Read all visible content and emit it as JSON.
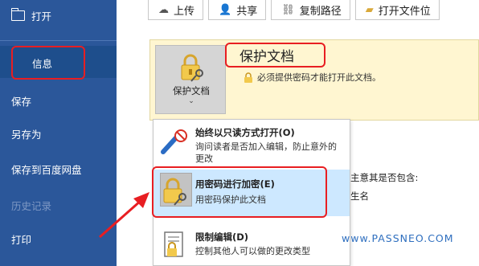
{
  "sidebar": {
    "open_label": "打开",
    "items": [
      {
        "label": "信息"
      },
      {
        "label": "保存"
      },
      {
        "label": "另存为"
      },
      {
        "label": "保存到百度网盘"
      },
      {
        "label": "历史记录"
      },
      {
        "label": "打印"
      }
    ]
  },
  "toolbar": {
    "upload": "上传",
    "share": "共享",
    "copy_path": "复制路径",
    "open_location": "打开文件位"
  },
  "protect": {
    "button_label": "保护文档",
    "chevron": "⌄",
    "title": "保护文档",
    "description": "必须提供密码才能打开此文档。"
  },
  "menu": {
    "items": [
      {
        "title": "始终以只读方式打开(O)",
        "desc": "询问读者是否加入编辑，防止意外的更改"
      },
      {
        "title": "用密码进行加密(E)",
        "desc": "用密码保护此文档"
      },
      {
        "title": "限制编辑(D)",
        "desc": "控制其他人可以做的更改类型"
      }
    ]
  },
  "background_text": {
    "line1": "主意其是否包含:",
    "line2": "生名"
  },
  "watermark": "www.PASSNEO.COM",
  "colors": {
    "sidebar": "#2b579a",
    "highlight": "#e81e22",
    "panel": "#fff6d1"
  }
}
